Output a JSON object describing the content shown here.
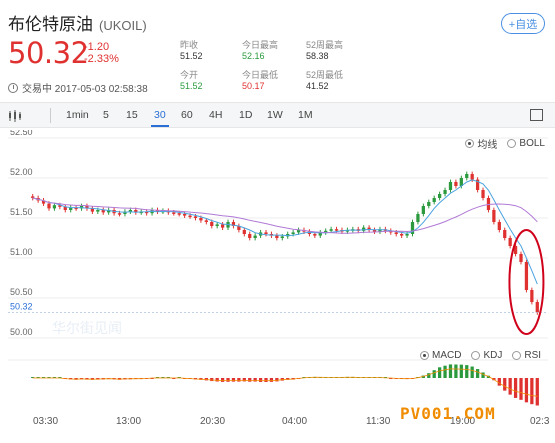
{
  "header": {
    "name": "布伦特原油",
    "code": "(UKOIL)",
    "watch_label": "+自选"
  },
  "quote": {
    "price": "50.32",
    "change": "-1.20",
    "change_pct": "-2.33%"
  },
  "stats": {
    "prev_close_label": "昨收",
    "prev_close": "51.52",
    "open_label": "今开",
    "open": "51.52",
    "high_label": "今日最高",
    "high": "52.16",
    "low_label": "今日最低",
    "low": "50.17",
    "w52_high_label": "52周最高",
    "w52_high": "58.38",
    "w52_low_label": "52周最低",
    "w52_low": "41.52"
  },
  "status": {
    "text": "交易中 2017-05-03 02:58:38"
  },
  "toolbar": {
    "periods": [
      "1min",
      "5",
      "15",
      "30",
      "60",
      "4H",
      "1D",
      "1W",
      "1M"
    ],
    "active": "30"
  },
  "overlays": {
    "ma_label": "均线",
    "boll_label": "BOLL"
  },
  "indicators": {
    "macd": "MACD",
    "kdj": "KDJ",
    "rsi": "RSI"
  },
  "watermark": {
    "logo_text": "华尔街见闻",
    "site_text": "PV001.COM"
  },
  "colors": {
    "up": "#2b9a3e",
    "down": "#e03131",
    "ma_blue": "#4aa3df",
    "ma_purple": "#b07ad6",
    "highlight_circle": "#d0021b"
  },
  "chart_data": {
    "type": "candlestick",
    "title": "",
    "xlabel": "",
    "ylabel": "",
    "ylim": [
      50.0,
      52.5
    ],
    "y_ticks": [
      "52.50",
      "52.00",
      "51.50",
      "51.00",
      "50.50",
      "50.00"
    ],
    "y_tick_values": [
      52.5,
      52.0,
      51.5,
      51.0,
      50.5,
      50.0
    ],
    "x_ticks": [
      "03:30",
      "13:00",
      "20:30",
      "04:00",
      "11:30",
      "19:00",
      "02:3"
    ],
    "last_price_label": "50.32",
    "closes": [
      51.75,
      51.72,
      51.68,
      51.62,
      51.66,
      51.64,
      51.6,
      51.63,
      51.62,
      51.65,
      51.62,
      51.58,
      51.6,
      51.57,
      51.6,
      51.56,
      51.55,
      51.58,
      51.6,
      51.57,
      51.58,
      51.56,
      51.6,
      51.58,
      51.59,
      51.57,
      51.56,
      51.55,
      51.53,
      51.52,
      51.5,
      51.47,
      51.45,
      51.4,
      51.42,
      51.38,
      51.45,
      51.4,
      51.35,
      51.3,
      51.25,
      51.28,
      51.32,
      51.3,
      51.28,
      51.25,
      51.27,
      51.3,
      51.32,
      51.35,
      51.33,
      51.3,
      51.28,
      51.32,
      51.34,
      51.36,
      51.35,
      51.33,
      51.35,
      51.36,
      51.34,
      51.38,
      51.35,
      51.33,
      51.36,
      51.34,
      51.32,
      51.3,
      51.28,
      51.3,
      51.45,
      51.55,
      51.65,
      51.7,
      51.75,
      51.8,
      51.85,
      51.95,
      51.9,
      52.0,
      52.05,
      51.98,
      51.85,
      51.75,
      51.6,
      51.45,
      51.35,
      51.25,
      51.15,
      51.05,
      50.95,
      50.6,
      50.45,
      50.32
    ]
  }
}
